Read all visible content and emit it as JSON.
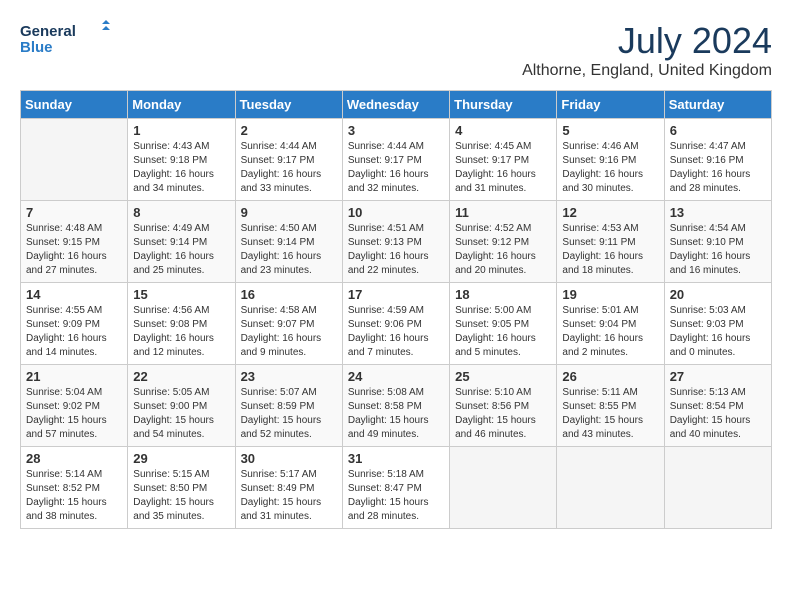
{
  "header": {
    "logo_line1": "General",
    "logo_line2": "Blue",
    "title": "July 2024",
    "subtitle": "Althorne, England, United Kingdom"
  },
  "days_of_week": [
    "Sunday",
    "Monday",
    "Tuesday",
    "Wednesday",
    "Thursday",
    "Friday",
    "Saturday"
  ],
  "weeks": [
    [
      {
        "num": "",
        "info": ""
      },
      {
        "num": "1",
        "info": "Sunrise: 4:43 AM\nSunset: 9:18 PM\nDaylight: 16 hours\nand 34 minutes."
      },
      {
        "num": "2",
        "info": "Sunrise: 4:44 AM\nSunset: 9:17 PM\nDaylight: 16 hours\nand 33 minutes."
      },
      {
        "num": "3",
        "info": "Sunrise: 4:44 AM\nSunset: 9:17 PM\nDaylight: 16 hours\nand 32 minutes."
      },
      {
        "num": "4",
        "info": "Sunrise: 4:45 AM\nSunset: 9:17 PM\nDaylight: 16 hours\nand 31 minutes."
      },
      {
        "num": "5",
        "info": "Sunrise: 4:46 AM\nSunset: 9:16 PM\nDaylight: 16 hours\nand 30 minutes."
      },
      {
        "num": "6",
        "info": "Sunrise: 4:47 AM\nSunset: 9:16 PM\nDaylight: 16 hours\nand 28 minutes."
      }
    ],
    [
      {
        "num": "7",
        "info": "Sunrise: 4:48 AM\nSunset: 9:15 PM\nDaylight: 16 hours\nand 27 minutes."
      },
      {
        "num": "8",
        "info": "Sunrise: 4:49 AM\nSunset: 9:14 PM\nDaylight: 16 hours\nand 25 minutes."
      },
      {
        "num": "9",
        "info": "Sunrise: 4:50 AM\nSunset: 9:14 PM\nDaylight: 16 hours\nand 23 minutes."
      },
      {
        "num": "10",
        "info": "Sunrise: 4:51 AM\nSunset: 9:13 PM\nDaylight: 16 hours\nand 22 minutes."
      },
      {
        "num": "11",
        "info": "Sunrise: 4:52 AM\nSunset: 9:12 PM\nDaylight: 16 hours\nand 20 minutes."
      },
      {
        "num": "12",
        "info": "Sunrise: 4:53 AM\nSunset: 9:11 PM\nDaylight: 16 hours\nand 18 minutes."
      },
      {
        "num": "13",
        "info": "Sunrise: 4:54 AM\nSunset: 9:10 PM\nDaylight: 16 hours\nand 16 minutes."
      }
    ],
    [
      {
        "num": "14",
        "info": "Sunrise: 4:55 AM\nSunset: 9:09 PM\nDaylight: 16 hours\nand 14 minutes."
      },
      {
        "num": "15",
        "info": "Sunrise: 4:56 AM\nSunset: 9:08 PM\nDaylight: 16 hours\nand 12 minutes."
      },
      {
        "num": "16",
        "info": "Sunrise: 4:58 AM\nSunset: 9:07 PM\nDaylight: 16 hours\nand 9 minutes."
      },
      {
        "num": "17",
        "info": "Sunrise: 4:59 AM\nSunset: 9:06 PM\nDaylight: 16 hours\nand 7 minutes."
      },
      {
        "num": "18",
        "info": "Sunrise: 5:00 AM\nSunset: 9:05 PM\nDaylight: 16 hours\nand 5 minutes."
      },
      {
        "num": "19",
        "info": "Sunrise: 5:01 AM\nSunset: 9:04 PM\nDaylight: 16 hours\nand 2 minutes."
      },
      {
        "num": "20",
        "info": "Sunrise: 5:03 AM\nSunset: 9:03 PM\nDaylight: 16 hours\nand 0 minutes."
      }
    ],
    [
      {
        "num": "21",
        "info": "Sunrise: 5:04 AM\nSunset: 9:02 PM\nDaylight: 15 hours\nand 57 minutes."
      },
      {
        "num": "22",
        "info": "Sunrise: 5:05 AM\nSunset: 9:00 PM\nDaylight: 15 hours\nand 54 minutes."
      },
      {
        "num": "23",
        "info": "Sunrise: 5:07 AM\nSunset: 8:59 PM\nDaylight: 15 hours\nand 52 minutes."
      },
      {
        "num": "24",
        "info": "Sunrise: 5:08 AM\nSunset: 8:58 PM\nDaylight: 15 hours\nand 49 minutes."
      },
      {
        "num": "25",
        "info": "Sunrise: 5:10 AM\nSunset: 8:56 PM\nDaylight: 15 hours\nand 46 minutes."
      },
      {
        "num": "26",
        "info": "Sunrise: 5:11 AM\nSunset: 8:55 PM\nDaylight: 15 hours\nand 43 minutes."
      },
      {
        "num": "27",
        "info": "Sunrise: 5:13 AM\nSunset: 8:54 PM\nDaylight: 15 hours\nand 40 minutes."
      }
    ],
    [
      {
        "num": "28",
        "info": "Sunrise: 5:14 AM\nSunset: 8:52 PM\nDaylight: 15 hours\nand 38 minutes."
      },
      {
        "num": "29",
        "info": "Sunrise: 5:15 AM\nSunset: 8:50 PM\nDaylight: 15 hours\nand 35 minutes."
      },
      {
        "num": "30",
        "info": "Sunrise: 5:17 AM\nSunset: 8:49 PM\nDaylight: 15 hours\nand 31 minutes."
      },
      {
        "num": "31",
        "info": "Sunrise: 5:18 AM\nSunset: 8:47 PM\nDaylight: 15 hours\nand 28 minutes."
      },
      {
        "num": "",
        "info": ""
      },
      {
        "num": "",
        "info": ""
      },
      {
        "num": "",
        "info": ""
      }
    ]
  ]
}
